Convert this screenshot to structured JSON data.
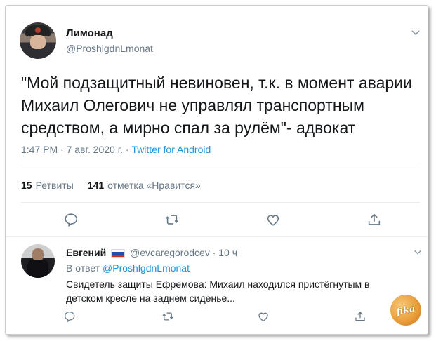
{
  "tweet": {
    "author_name": "Лимонад",
    "author_handle": "@ProshlgdnLmonat",
    "text": "\"Мой подзащитный невиновен, т.к. в момент аварии Михаил Олегович не управлял транспортным средством, а мирно спал за рулём\"- адвокат",
    "time_date": "1:47 PM · 7 авг. 2020 г. · ",
    "client": "Twitter for Android",
    "retweet_count": "15",
    "retweet_label": "Ретвиты",
    "like_count": "141",
    "like_label": "отметка «Нравится»",
    "icons": [
      "reply-icon",
      "retweet-icon",
      "like-icon",
      "share-icon",
      "chevron-down-icon"
    ]
  },
  "reply": {
    "author_name": "Евгений",
    "flag_colors": [
      "#ffffff",
      "#1f4fa8",
      "#d52b1e"
    ],
    "handle_time": "@evcaregorodcev · 10 ч",
    "in_reply_prefix": "В ответ ",
    "in_reply_handle": "@ProshlgdnLmonat",
    "text": "Свидетель защиты Ефремова: Михаил находился пристёгнутым в детском кресле на заднем сиденье..."
  },
  "watermark": {
    "text": "fika"
  },
  "colors": {
    "link": "#1b95e0",
    "secondary": "#657786",
    "primary_text": "#14171a"
  }
}
